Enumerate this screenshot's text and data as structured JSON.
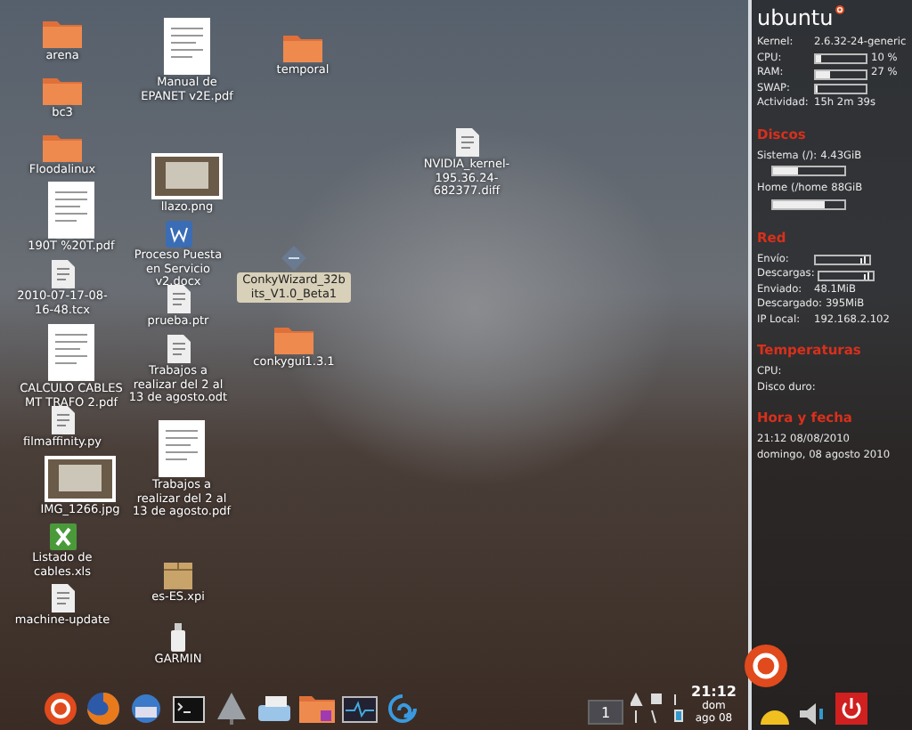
{
  "desktop_icons": [
    {
      "label": "arena",
      "kind": "folder",
      "selected": false
    },
    {
      "label": "bc3",
      "kind": "folder",
      "selected": false
    },
    {
      "label": "Floodalinux",
      "kind": "folder",
      "selected": false
    },
    {
      "label": "190T %20T.pdf",
      "kind": "pdf",
      "selected": false
    },
    {
      "label": "2010-07-17-08-16-48.tcx",
      "kind": "file",
      "selected": false
    },
    {
      "label": "CALCULO CABLES MT TRAFO 2.pdf",
      "kind": "pdf",
      "selected": false
    },
    {
      "label": "filmaffinity.py",
      "kind": "file",
      "selected": false
    },
    {
      "label": "IMG_1266.jpg",
      "kind": "image",
      "selected": false
    },
    {
      "label": "Listado de cables.xls",
      "kind": "spreadsheet",
      "selected": false
    },
    {
      "label": "machine-update",
      "kind": "file",
      "selected": false
    },
    {
      "label": "Manual de EPANET v2E.pdf",
      "kind": "pdf",
      "selected": false
    },
    {
      "label": "llazo.png",
      "kind": "image",
      "selected": false
    },
    {
      "label": "Proceso Puesta en Servicio v2.docx",
      "kind": "word",
      "selected": false
    },
    {
      "label": "prueba.ptr",
      "kind": "file",
      "selected": false
    },
    {
      "label": "Trabajos a realizar del 2 al 13 de agosto.odt",
      "kind": "file",
      "selected": false
    },
    {
      "label": "Trabajos a realizar del 2 al 13 de agosto.pdf",
      "kind": "pdf",
      "selected": false
    },
    {
      "label": "es-ES.xpi",
      "kind": "package",
      "selected": false
    },
    {
      "label": "GARMIN",
      "kind": "usb",
      "selected": false
    },
    {
      "label": "temporal",
      "kind": "folder",
      "selected": false
    },
    {
      "label": "ConkyWizard_32bits_V1.0_Beta1",
      "kind": "app",
      "selected": true
    },
    {
      "label": "conkygui1.3.1",
      "kind": "folder",
      "selected": false
    },
    {
      "label": "NVIDIA_kernel-195.36.24-682377.diff",
      "kind": "file",
      "selected": false
    }
  ],
  "conky": {
    "logo": "ubuntu",
    "sections": [
      {
        "rows": [
          {
            "kind": "text",
            "label": "Kernel:",
            "value": "2.6.32-24-generic"
          },
          {
            "kind": "bar",
            "label": "CPU:",
            "level": 0.1,
            "value": "10 %"
          },
          {
            "kind": "bar",
            "label": "RAM:",
            "level": 0.27,
            "value": "27 %"
          },
          {
            "kind": "bar",
            "label": "SWAP:",
            "level": 0
          },
          {
            "kind": "text",
            "label": "Actividad:",
            "value": "15h 2m 39s"
          }
        ]
      },
      {
        "title": "Discos",
        "rows": [
          {
            "kind": "disk",
            "label": "Sistema (/):",
            "value": "4.43GiB",
            "level": 0.35
          },
          {
            "kind": "disk",
            "label": "Home (/home",
            "value": "88GiB",
            "level": 0.72
          }
        ]
      },
      {
        "title": "Red",
        "rows": [
          {
            "kind": "graph",
            "label": "Envío:"
          },
          {
            "kind": "graph",
            "label": "Descargas:"
          },
          {
            "kind": "text",
            "label": "Enviado:",
            "value": "48.1MiB"
          },
          {
            "kind": "text",
            "label": "Descargado:",
            "value": "395MiB"
          },
          {
            "kind": "text",
            "label": "IP Local:",
            "value": "192.168.2.102"
          }
        ]
      },
      {
        "title": "Temperaturas",
        "rows": [
          {
            "kind": "text",
            "label": "CPU:"
          },
          {
            "kind": "text",
            "label": "Disco duro:"
          }
        ]
      },
      {
        "title": "Hora y fecha",
        "rows": [
          {
            "kind": "text",
            "label": "21:12  08/08/2010"
          },
          {
            "kind": "text",
            "label": "domingo, 08 agosto 2010"
          }
        ]
      }
    ]
  },
  "dock": [
    {
      "kind": "ubuntu"
    },
    {
      "kind": "firefox"
    },
    {
      "kind": "mail"
    },
    {
      "kind": "terminal"
    },
    {
      "kind": "triangle"
    },
    {
      "kind": "scanner"
    },
    {
      "kind": "folder"
    },
    {
      "kind": "monitor"
    },
    {
      "kind": "swirl"
    }
  ],
  "tray": {
    "workspace": "1",
    "time": "21:12",
    "day": "dom",
    "date": "ago 08"
  }
}
